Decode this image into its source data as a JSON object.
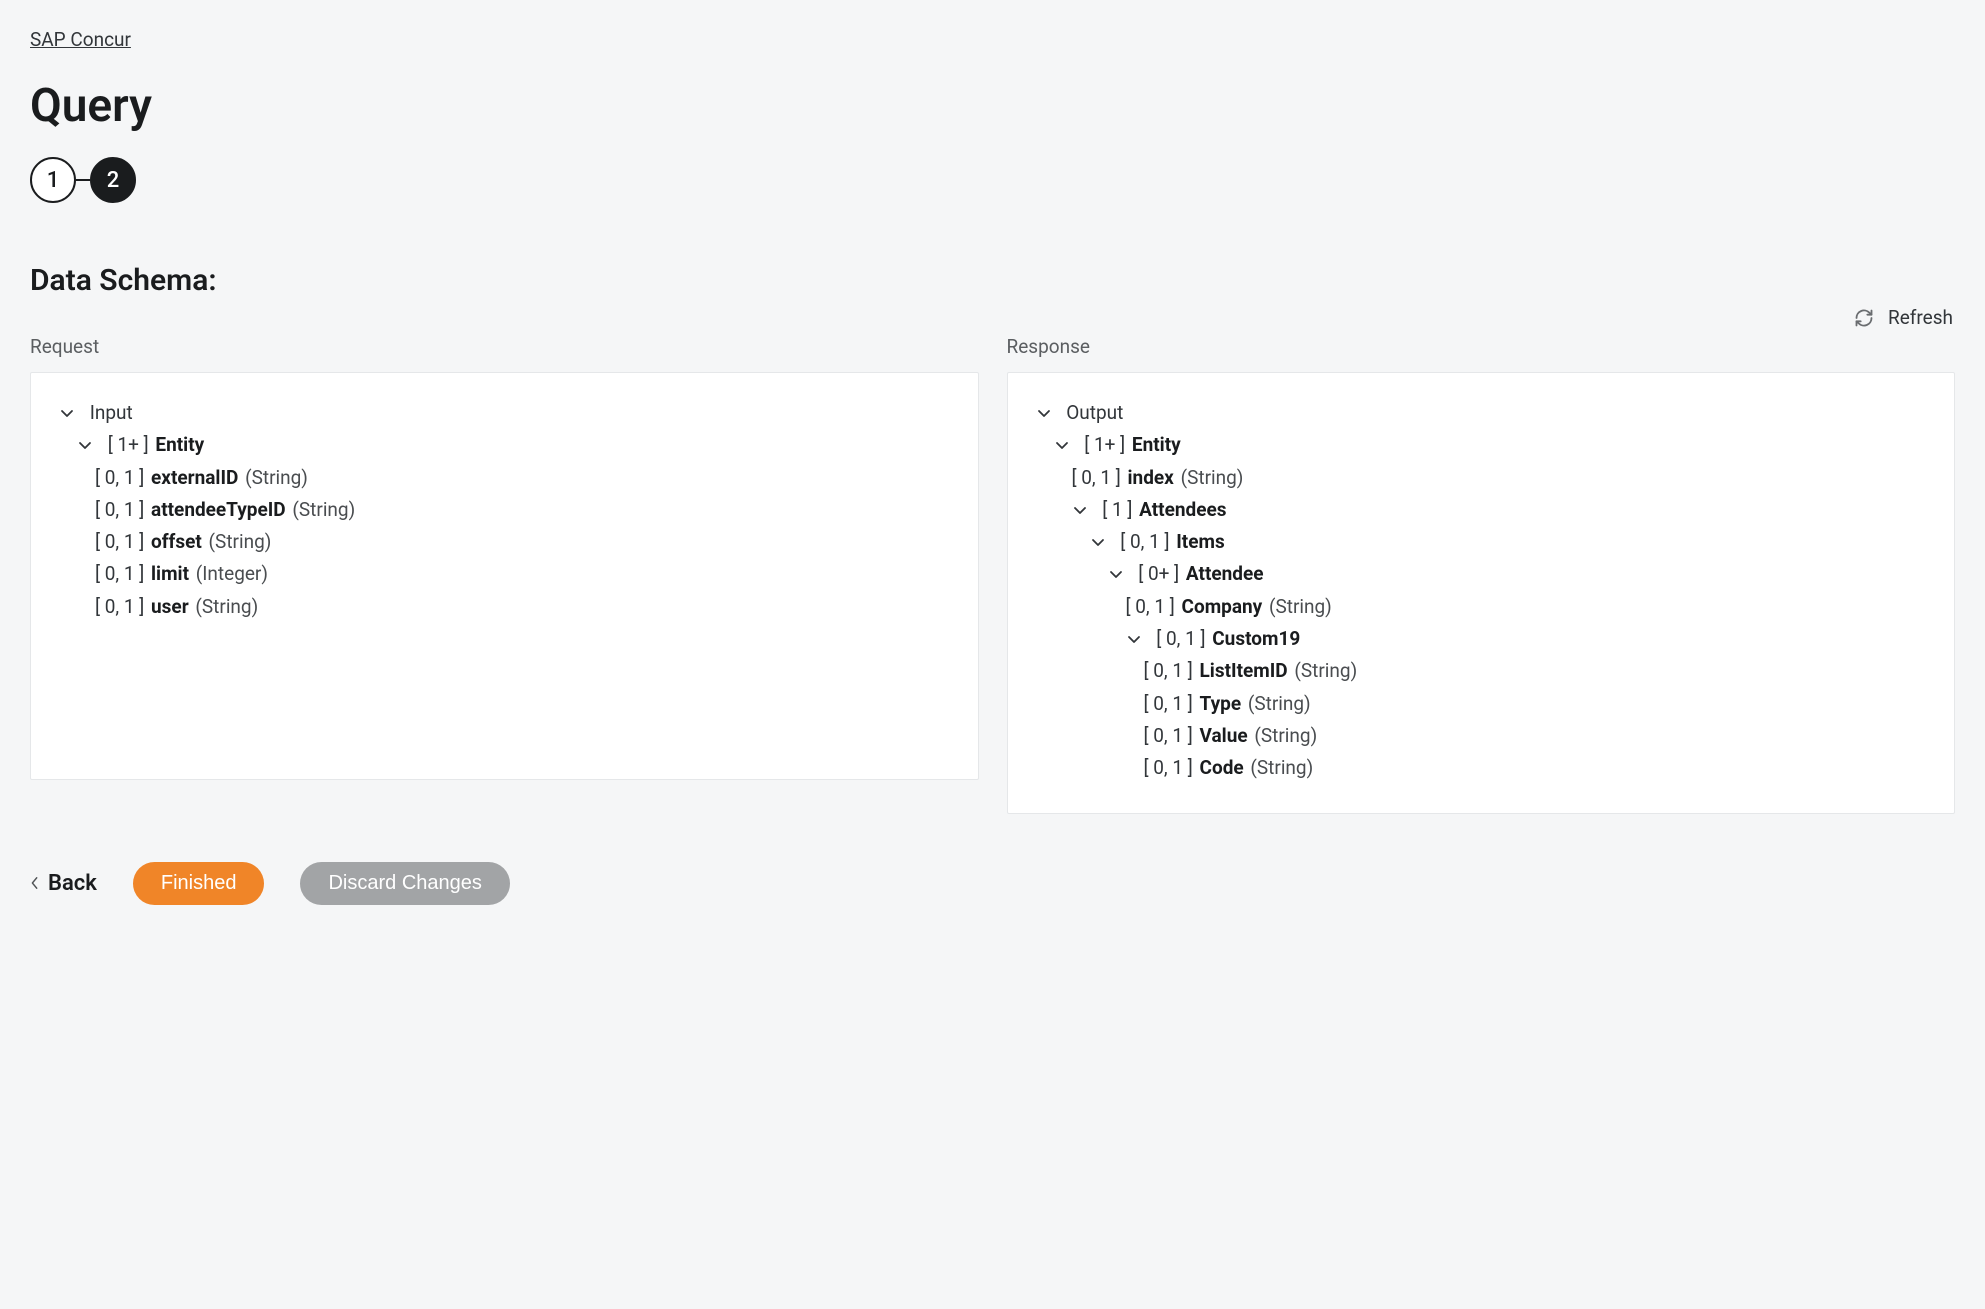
{
  "breadcrumb": "SAP Concur",
  "title": "Query",
  "stepper": {
    "steps": [
      "1",
      "2"
    ],
    "activeIndex": 1
  },
  "sectionTitle": "Data Schema:",
  "refreshLabel": "Refresh",
  "requestLabel": "Request",
  "responseLabel": "Response",
  "request": {
    "rootLabel": "Input",
    "entity": {
      "card": "[ 1+ ]",
      "name": "Entity",
      "fields": [
        {
          "card": "[ 0, 1 ]",
          "name": "externalID",
          "type": "(String)"
        },
        {
          "card": "[ 0, 1 ]",
          "name": "attendeeTypeID",
          "type": "(String)"
        },
        {
          "card": "[ 0, 1 ]",
          "name": "offset",
          "type": "(String)"
        },
        {
          "card": "[ 0, 1 ]",
          "name": "limit",
          "type": "(Integer)"
        },
        {
          "card": "[ 0, 1 ]",
          "name": "user",
          "type": "(String)"
        }
      ]
    }
  },
  "response": {
    "rootLabel": "Output",
    "entity": {
      "card": "[ 1+ ]",
      "name": "Entity",
      "index": {
        "card": "[ 0, 1 ]",
        "name": "index",
        "type": "(String)"
      },
      "attendees": {
        "card": "[ 1 ]",
        "name": "Attendees",
        "items": {
          "card": "[ 0, 1 ]",
          "name": "Items",
          "attendee": {
            "card": "[ 0+ ]",
            "name": "Attendee",
            "company": {
              "card": "[ 0, 1 ]",
              "name": "Company",
              "type": "(String)"
            },
            "custom19": {
              "card": "[ 0, 1 ]",
              "name": "Custom19",
              "fields": [
                {
                  "card": "[ 0, 1 ]",
                  "name": "ListItemID",
                  "type": "(String)"
                },
                {
                  "card": "[ 0, 1 ]",
                  "name": "Type",
                  "type": "(String)"
                },
                {
                  "card": "[ 0, 1 ]",
                  "name": "Value",
                  "type": "(String)"
                },
                {
                  "card": "[ 0, 1 ]",
                  "name": "Code",
                  "type": "(String)"
                }
              ]
            }
          }
        }
      }
    }
  },
  "footer": {
    "back": "Back",
    "finished": "Finished",
    "discard": "Discard Changes"
  }
}
